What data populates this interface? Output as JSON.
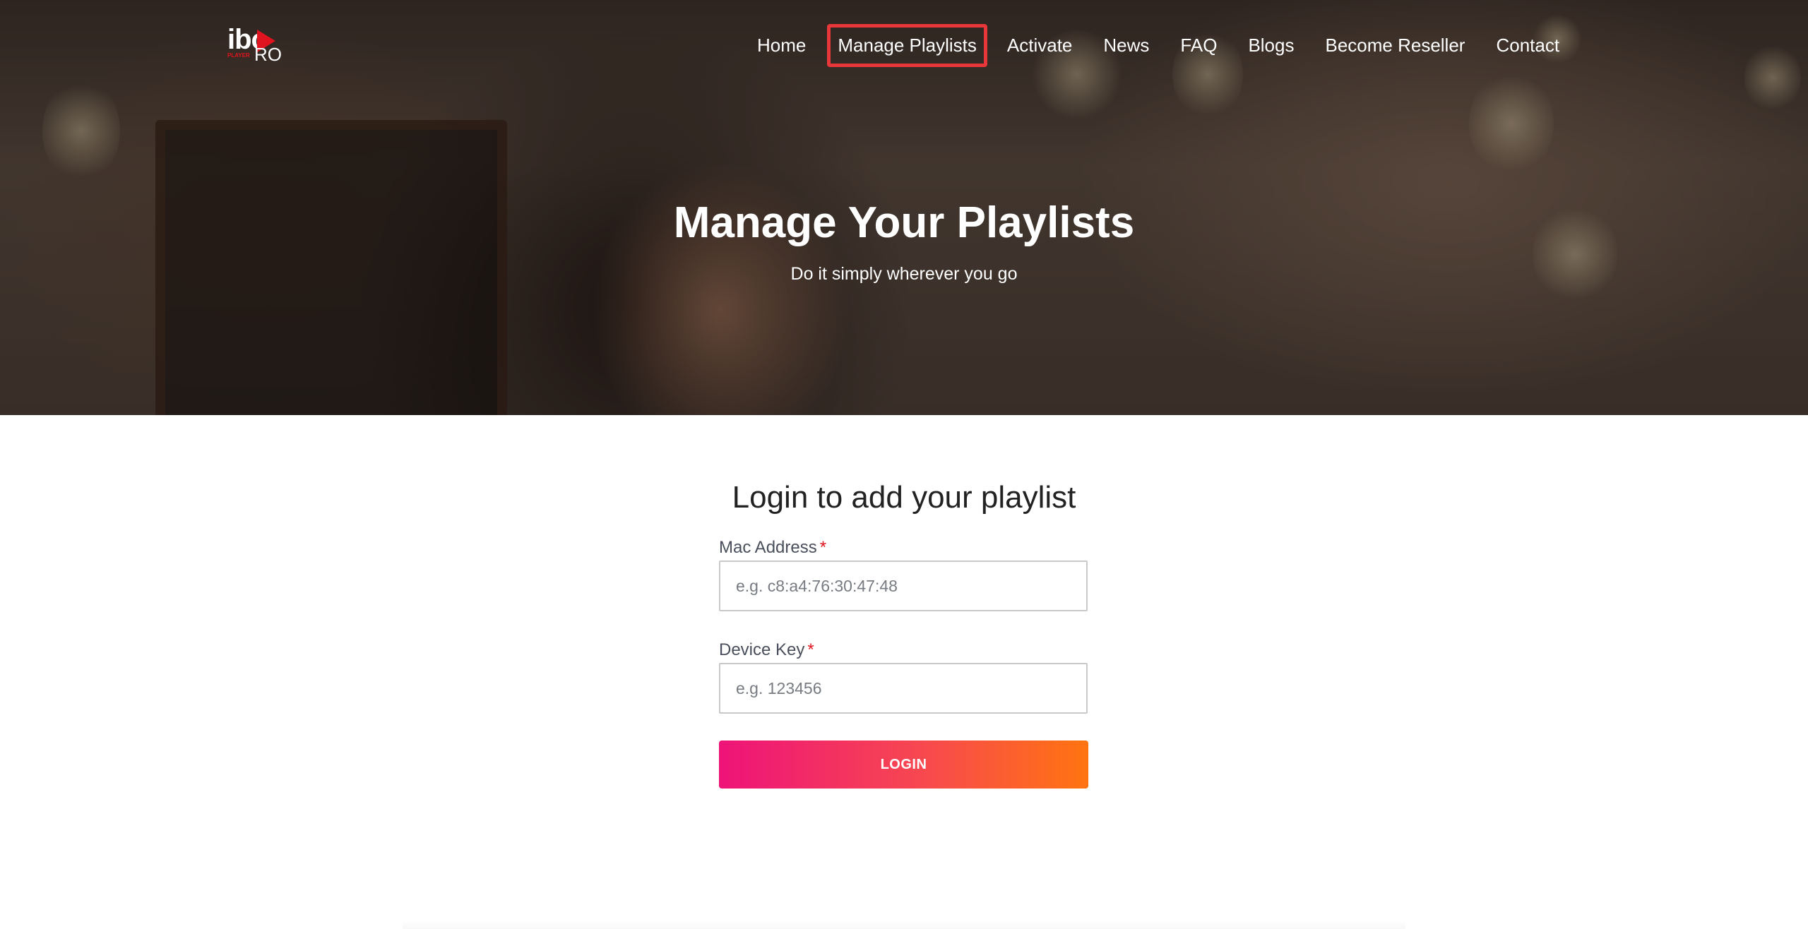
{
  "logo": {
    "text_main": "ibo",
    "text_sub": "RO",
    "text_tiny": "PLAYER"
  },
  "nav": {
    "items": [
      {
        "label": "Home"
      },
      {
        "label": "Manage Playlists",
        "active": true
      },
      {
        "label": "Activate"
      },
      {
        "label": "News"
      },
      {
        "label": "FAQ"
      },
      {
        "label": "Blogs"
      },
      {
        "label": "Become Reseller"
      },
      {
        "label": "Contact"
      }
    ],
    "active_highlight_color": "#e8373a"
  },
  "hero": {
    "title": "Manage Your Playlists",
    "subtitle": "Do it simply wherever you go"
  },
  "form": {
    "title": "Login to add your playlist",
    "mac": {
      "label": "Mac Address",
      "required_mark": "*",
      "placeholder": "e.g. c8:a4:76:30:47:48",
      "value": ""
    },
    "device_key": {
      "label": "Device Key",
      "required_mark": "*",
      "placeholder": "e.g. 123456",
      "value": ""
    },
    "submit_label": "LOGIN"
  },
  "colors": {
    "button_gradient_start": "#ee1379",
    "button_gradient_end": "#ff7410",
    "required": "#e0141e"
  }
}
